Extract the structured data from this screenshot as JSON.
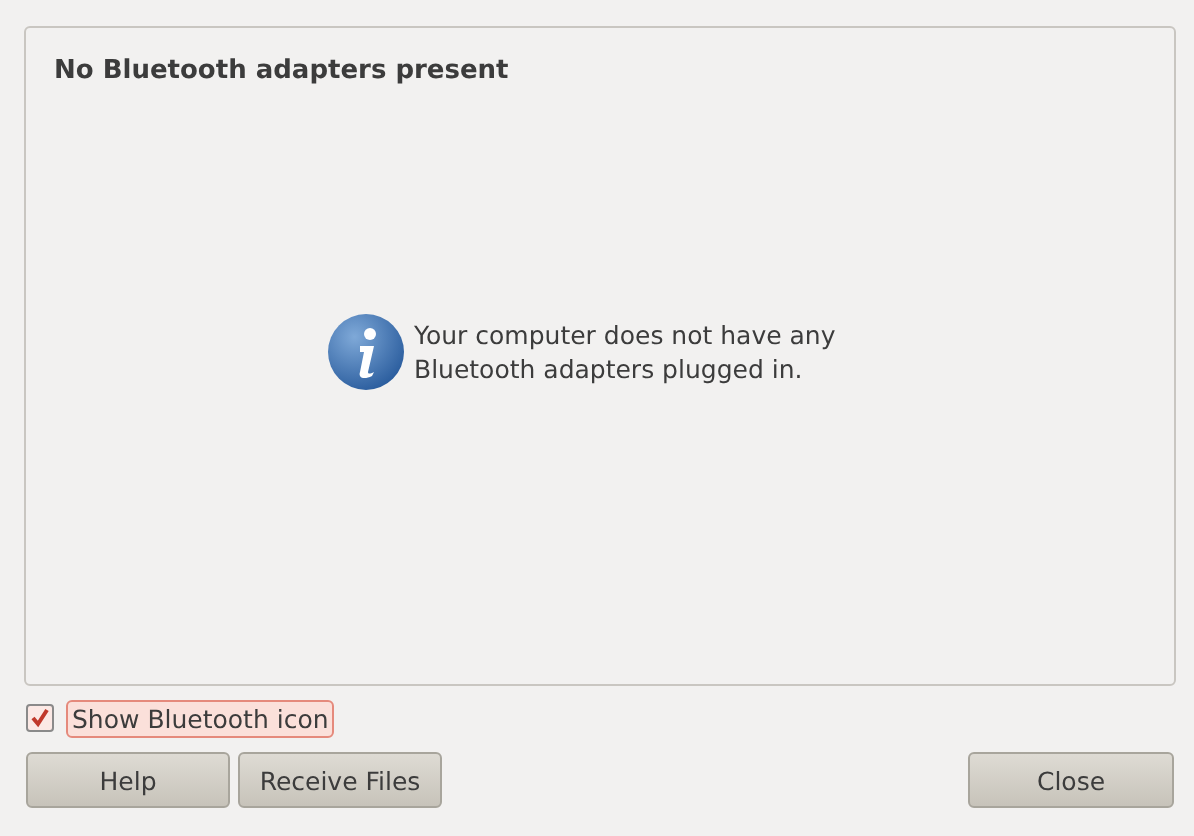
{
  "panel": {
    "title": "No Bluetooth adapters present",
    "message": "Your computer does not have any Bluetooth adapters plugged in."
  },
  "checkbox": {
    "label": "Show Bluetooth icon",
    "checked": true,
    "focused": true
  },
  "buttons": [
    {
      "label": "Help",
      "kind": "left"
    },
    {
      "label": "Receive Files",
      "kind": "left"
    },
    {
      "label": "Close",
      "kind": "right"
    }
  ]
}
